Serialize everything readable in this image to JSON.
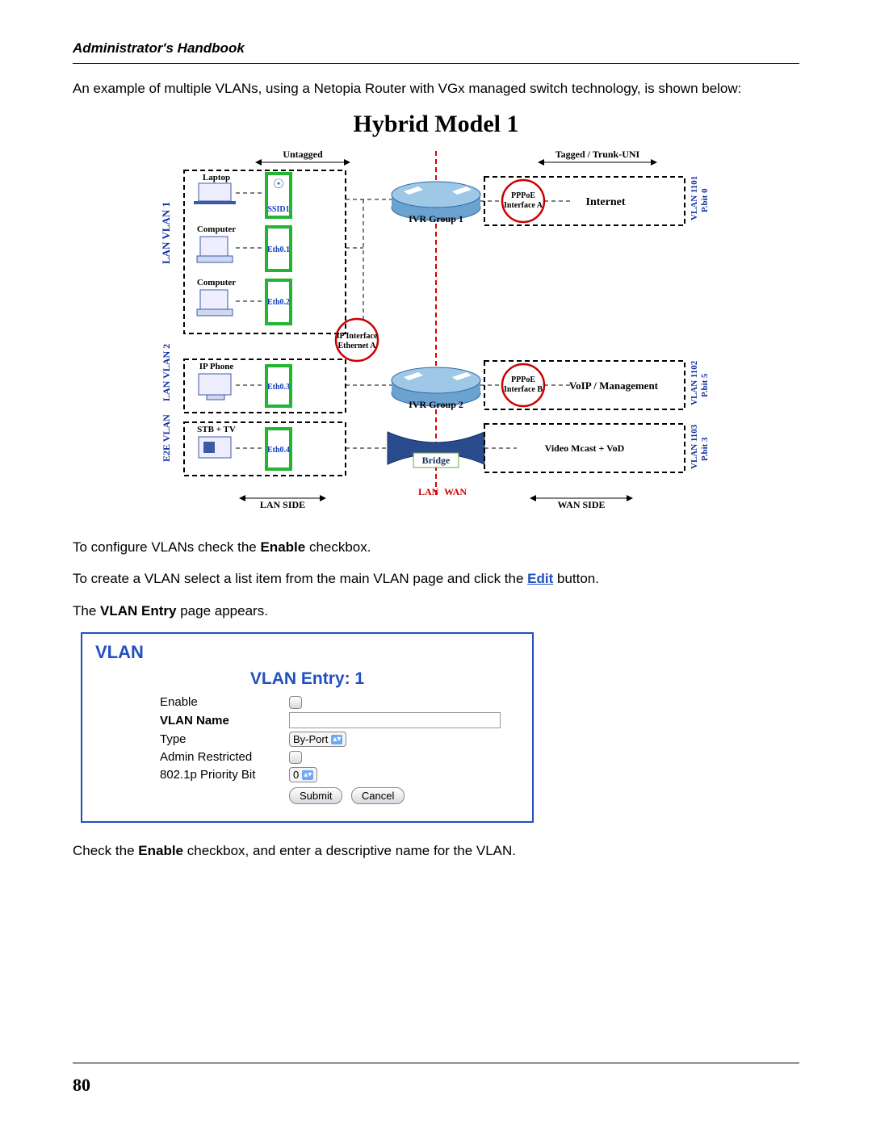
{
  "header": "Administrator's Handbook",
  "intro": "An example of multiple VLANs, using a Netopia Router with VGx managed switch technology, is shown below:",
  "diagram": {
    "title": "Hybrid Model 1",
    "left_tags": [
      "LAN VLAN 1",
      "LAN VLAN 2",
      "E2E VLAN"
    ],
    "right_tags": [
      {
        "a": "VLAN 1101",
        "b": "P.bit 0"
      },
      {
        "a": "VLAN 1102",
        "b": "P.bit 5"
      },
      {
        "a": "VLAN 1103",
        "b": "P.bit 3"
      }
    ],
    "untagged": "Untagged",
    "tagged": "Tagged  / Trunk-UNI",
    "laptop": "Laptop",
    "computer": "Computer",
    "ipphone": "IP Phone",
    "stb": "STB + TV",
    "ssid": "SSID1",
    "eth01": "Eth0.1",
    "eth02": "Eth0.2",
    "eth03": "Eth0.3",
    "eth04": "Eth0.4",
    "ivr1": "IVR Group 1",
    "ivr2": "IVR Group 2",
    "bridge": "Bridge",
    "ipif": "IP Interface\nEthernet A",
    "pppoea": "PPPoE\nInterface A",
    "pppoeb": "PPPoE\nInterface B",
    "internet": "Internet",
    "voip": "VoIP / Management",
    "video": "Video Mcast + VoD",
    "lan": "LAN",
    "wan": "WAN",
    "lanside": "LAN SIDE",
    "wanside": "WAN SIDE"
  },
  "p1a": "To configure VLANs check the ",
  "p1b": "Enable",
  "p1c": " checkbox.",
  "p2a": "To create a VLAN select a list item from the main VLAN page and click the ",
  "p2b": "Edit",
  "p2c": " button.",
  "p3a": "The ",
  "p3b": "VLAN Entry",
  "p3c": " page appears.",
  "form": {
    "panel_title": "VLAN",
    "entry_title": "VLAN Entry: 1",
    "enable": "Enable",
    "vlan_name": "VLAN Name",
    "type": "Type",
    "type_value": "By-Port",
    "admin": "Admin Restricted",
    "pbit": "802.1p Priority Bit",
    "pbit_value": "0",
    "submit": "Submit",
    "cancel": "Cancel"
  },
  "p4a": "Check the ",
  "p4b": "Enable",
  "p4c": " checkbox, and enter a descriptive name for the VLAN.",
  "page_number": "80"
}
